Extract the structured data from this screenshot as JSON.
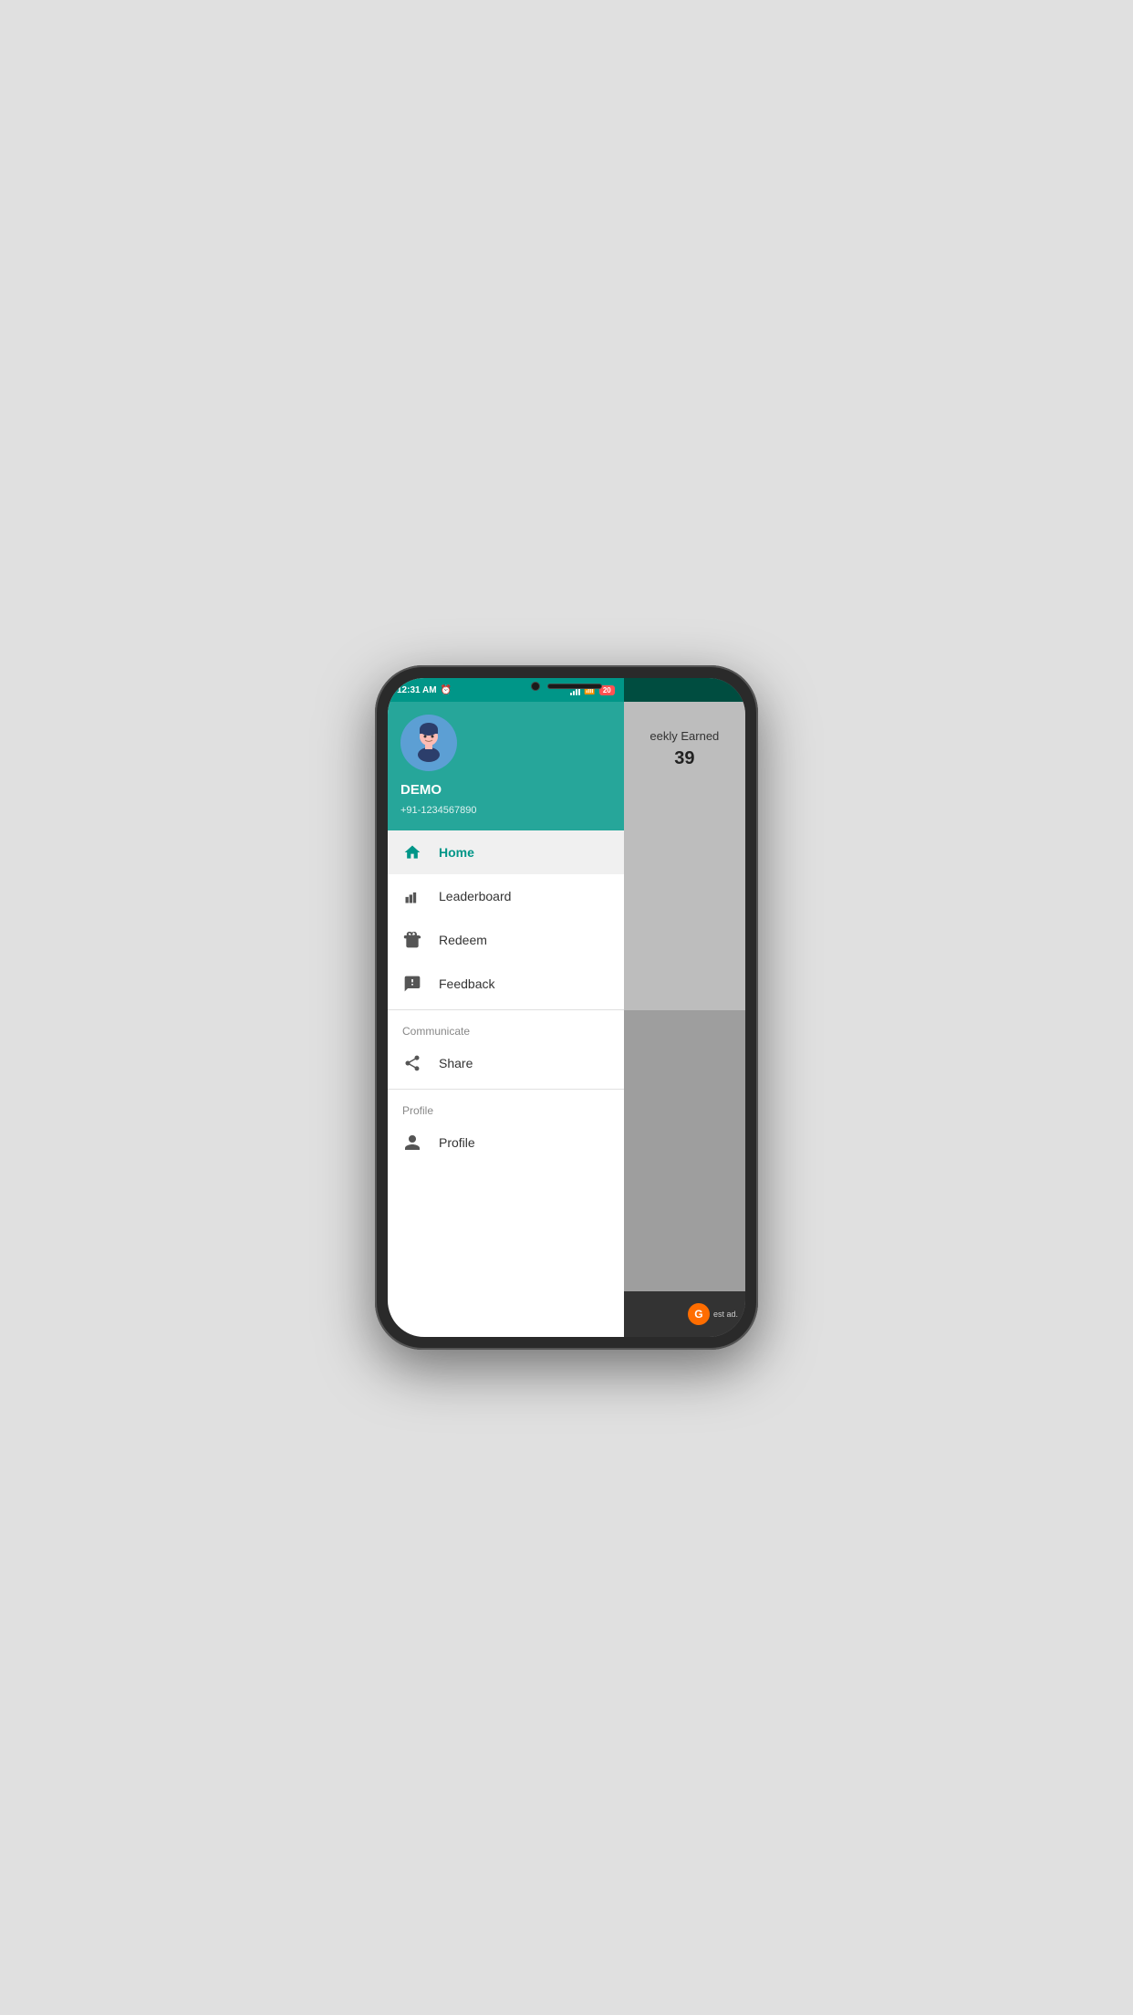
{
  "phone": {
    "status_bar": {
      "time": "12:31 AM",
      "battery_level": "20"
    },
    "drawer": {
      "user": {
        "name": "DEMO",
        "phone": "+91-1234567890"
      },
      "menu_items": [
        {
          "id": "home",
          "label": "Home",
          "icon": "home",
          "active": true
        },
        {
          "id": "leaderboard",
          "label": "Leaderboard",
          "icon": "leaderboard",
          "active": false
        },
        {
          "id": "redeem",
          "label": "Redeem",
          "icon": "redeem",
          "active": false
        },
        {
          "id": "feedback",
          "label": "Feedback",
          "icon": "feedback",
          "active": false
        }
      ],
      "communicate_section": {
        "header": "Communicate",
        "items": [
          {
            "id": "share",
            "label": "Share",
            "icon": "share"
          }
        ]
      },
      "profile_section": {
        "header": "Profile",
        "items": [
          {
            "id": "profile",
            "label": "Profile",
            "icon": "profile"
          }
        ]
      }
    },
    "main_content": {
      "weekly_label": "eekly Earned",
      "weekly_number": "39",
      "ad_text": "est ad."
    }
  }
}
